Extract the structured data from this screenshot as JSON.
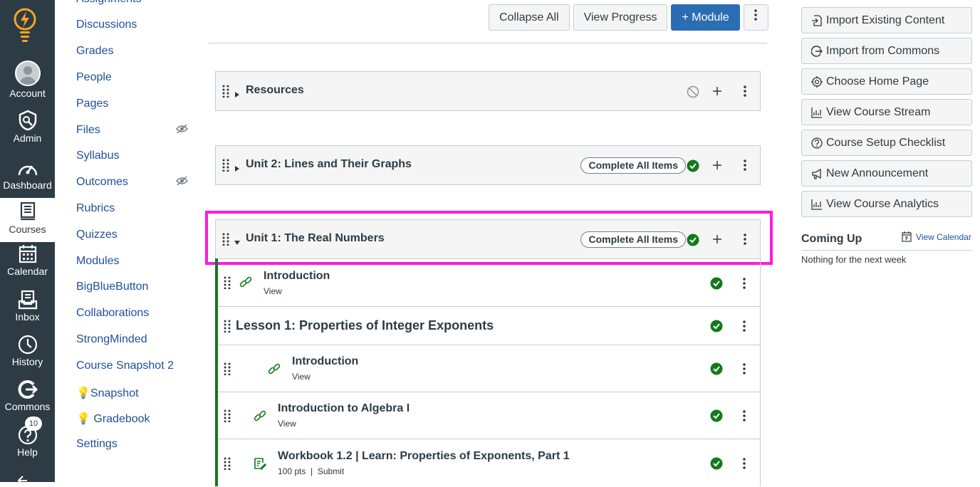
{
  "global_nav": {
    "items": [
      {
        "label": "Account",
        "icon": "user-avatar-icon"
      },
      {
        "label": "Admin",
        "icon": "shield-icon"
      },
      {
        "label": "Dashboard",
        "icon": "speedometer-icon"
      },
      {
        "label": "Courses",
        "icon": "book-icon",
        "active": true
      },
      {
        "label": "Calendar",
        "icon": "calendar-icon"
      },
      {
        "label": "Inbox",
        "icon": "inbox-icon"
      },
      {
        "label": "History",
        "icon": "clock-icon"
      },
      {
        "label": "Commons",
        "icon": "commons-icon"
      },
      {
        "label": "Help",
        "icon": "question-icon",
        "badge": "10"
      }
    ]
  },
  "course_nav": {
    "items": [
      {
        "label": "Assignments"
      },
      {
        "label": "Discussions"
      },
      {
        "label": "Grades"
      },
      {
        "label": "People"
      },
      {
        "label": "Pages"
      },
      {
        "label": "Files",
        "hidden": true
      },
      {
        "label": "Syllabus"
      },
      {
        "label": "Outcomes",
        "hidden": true
      },
      {
        "label": "Rubrics"
      },
      {
        "label": "Quizzes"
      },
      {
        "label": "Modules"
      },
      {
        "label": "BigBlueButton"
      },
      {
        "label": "Collaborations"
      },
      {
        "label": "StrongMinded"
      },
      {
        "label": "Course Snapshot 2"
      },
      {
        "label": "💡Snapshot"
      },
      {
        "label": "💡 Gradebook"
      },
      {
        "label": "Settings"
      }
    ]
  },
  "toolbar": {
    "collapse_all": "Collapse All",
    "view_progress": "View Progress",
    "add_module": "Module"
  },
  "modules": [
    {
      "title": "Resources",
      "expanded": false,
      "published": false
    },
    {
      "title": "Unit 2: Lines and Their Graphs",
      "expanded": false,
      "requirement": "Complete All Items",
      "published": true
    },
    {
      "title": "Unit 1: The Real Numbers",
      "expanded": true,
      "requirement": "Complete All Items",
      "published": true,
      "items": [
        {
          "title": "Introduction",
          "subtitle": "View",
          "type": "link"
        },
        {
          "title": "Lesson 1: Properties of Integer Exponents",
          "type": "header"
        },
        {
          "title": "Introduction",
          "subtitle": "View",
          "type": "link",
          "indent": 1
        },
        {
          "title": "Introduction to Algebra I",
          "subtitle": "View",
          "type": "link"
        },
        {
          "title": "Workbook 1.2 | Learn: Properties of Exponents, Part 1",
          "subtitle": "100 pts  |  Submit",
          "type": "assignment"
        }
      ]
    }
  ],
  "sidebar": {
    "buttons": [
      {
        "label": "Import Existing Content",
        "icon": "import-icon"
      },
      {
        "label": "Import from Commons",
        "icon": "commons-icon"
      },
      {
        "label": "Choose Home Page",
        "icon": "target-icon"
      },
      {
        "label": "View Course Stream",
        "icon": "stream-chart-icon"
      },
      {
        "label": "Course Setup Checklist",
        "icon": "question-circle-icon"
      },
      {
        "label": "New Announcement",
        "icon": "megaphone-icon"
      },
      {
        "label": "View Course Analytics",
        "icon": "analytics-chart-icon"
      }
    ],
    "coming_up": {
      "title": "Coming Up",
      "view_calendar": "View Calendar",
      "empty_text": "Nothing for the next week"
    }
  },
  "colors": {
    "nav_bg": "#2d3b45",
    "link": "#1f4f99",
    "primary": "#2b6db3",
    "published": "#127a1b",
    "focus": "#ff19e0",
    "logo": "#f5a623"
  }
}
